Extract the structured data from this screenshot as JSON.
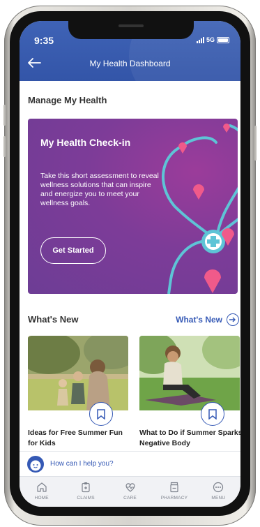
{
  "status": {
    "time": "9:35",
    "network": "5G"
  },
  "header": {
    "title": "My Health Dashboard"
  },
  "section": {
    "title": "Manage My Health"
  },
  "checkin": {
    "title": "My Health Check-in",
    "body": "Take this short assessment to reveal wellness solutions that can inspire and energize you to meet your wellness goals.",
    "cta": "Get Started"
  },
  "whats_new": {
    "title": "What's New",
    "link": "What's New",
    "articles": [
      {
        "title": "Ideas for Free Summer Fun for Kids"
      },
      {
        "title": "What to Do if Summer Sparks Negative Body"
      }
    ]
  },
  "assistant": {
    "prompt": "How can I help you?"
  },
  "tabs": [
    {
      "label": "HOME",
      "icon": "home-icon"
    },
    {
      "label": "CLAIMS",
      "icon": "clipboard-icon"
    },
    {
      "label": "CARE",
      "icon": "heart-pulse-icon"
    },
    {
      "label": "PHARMACY",
      "icon": "pharmacy-icon"
    },
    {
      "label": "MENU",
      "icon": "more-icon"
    }
  ],
  "colors": {
    "header": "#3f63b6",
    "accent": "#3559b5",
    "card": "#7d3c98",
    "pin": "#f05a8a",
    "stethoscope": "#5ec4d6"
  }
}
